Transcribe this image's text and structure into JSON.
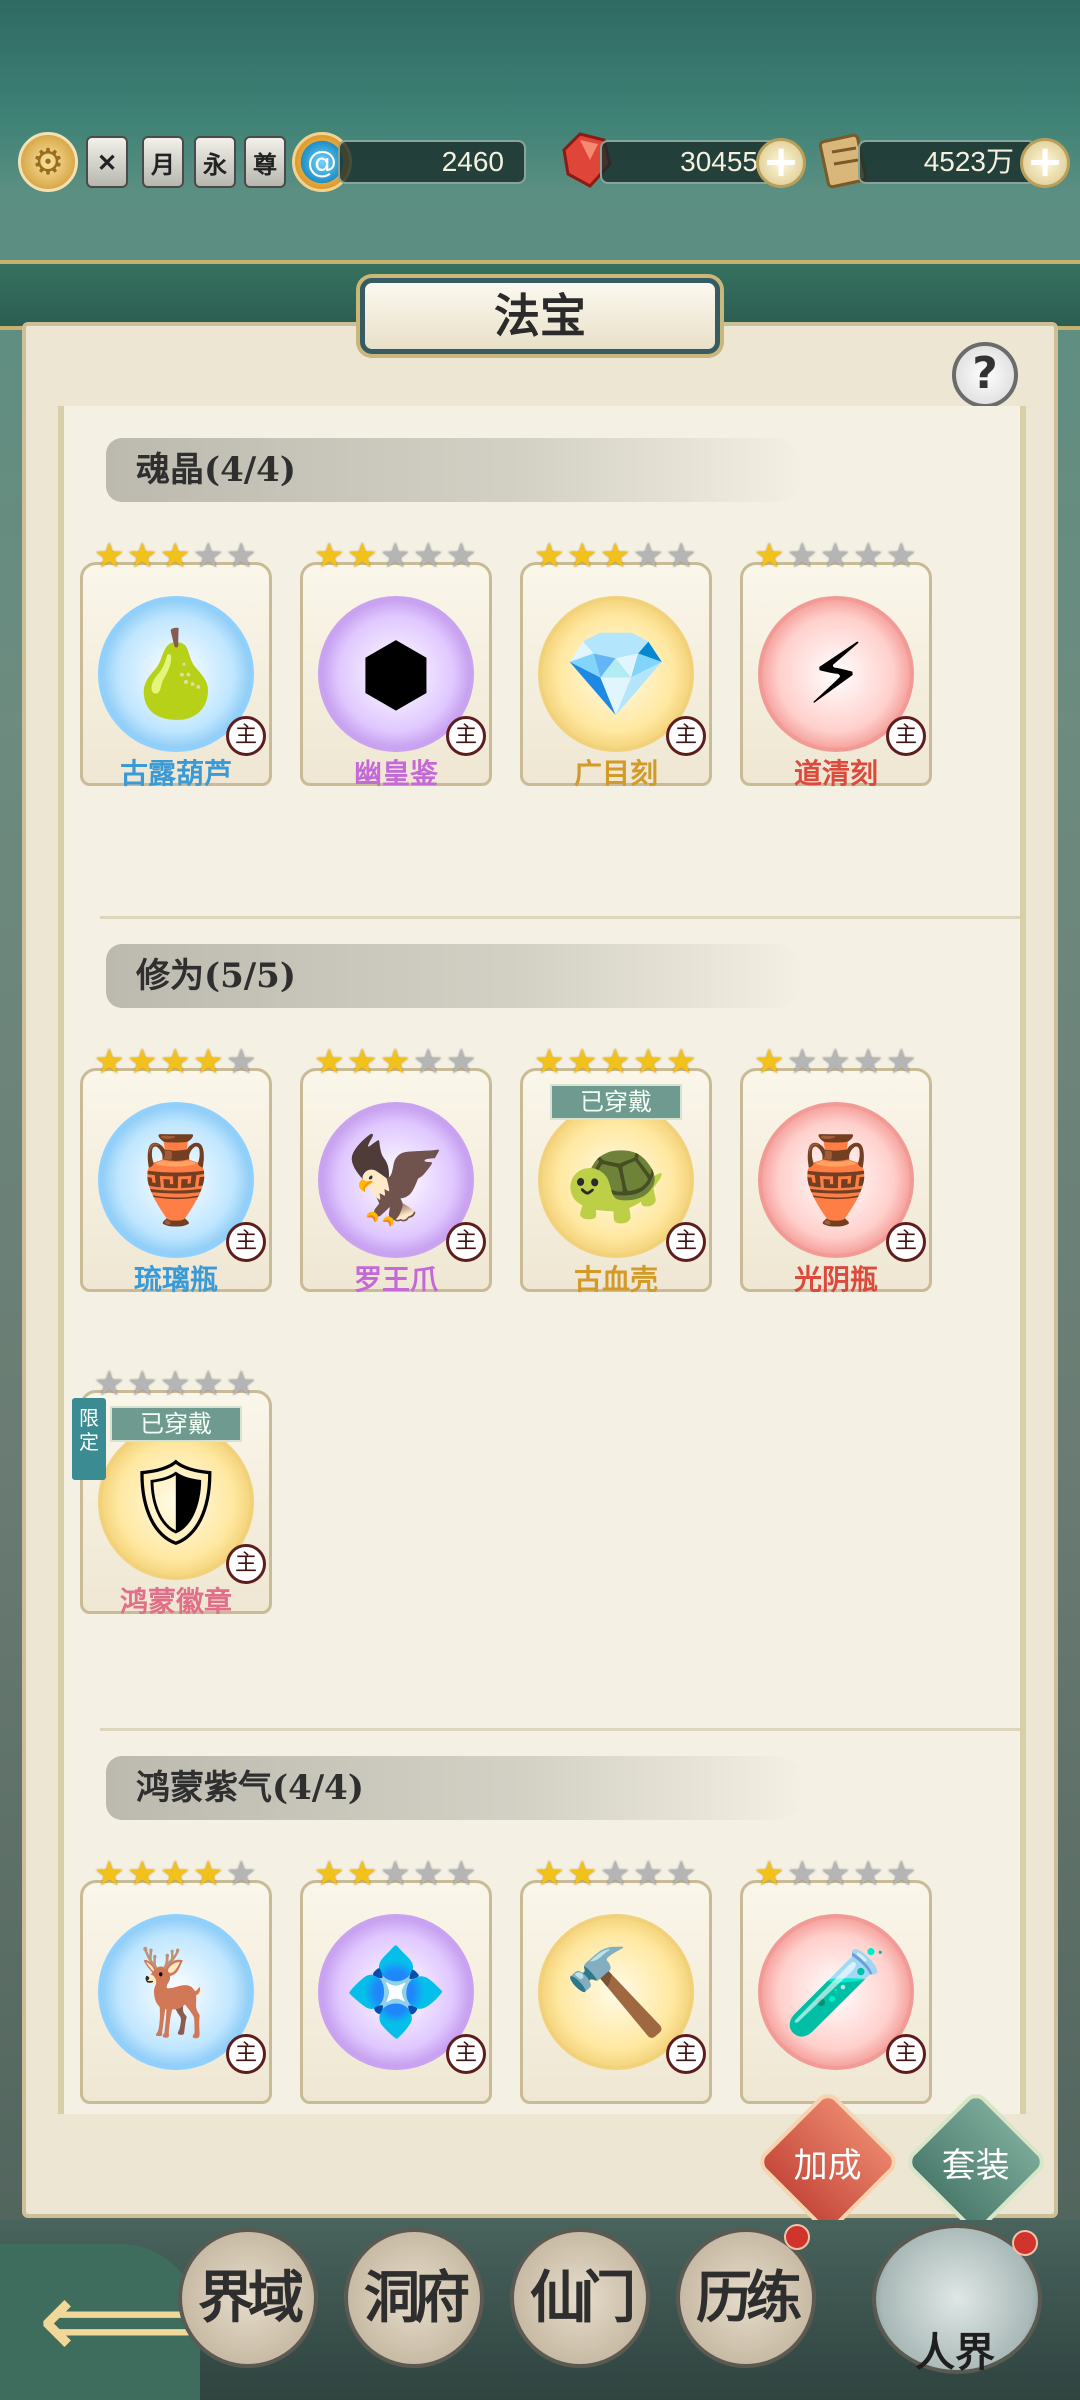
{
  "header": {
    "currency_1": "2460",
    "currency_2": "30455",
    "currency_3": "4523万",
    "badges": [
      "月",
      "永",
      "尊"
    ]
  },
  "page": {
    "title": "法宝"
  },
  "sections": [
    {
      "title": "魂晶(4/4)",
      "items": [
        {
          "name": "古露葫芦",
          "stars": 3,
          "max_stars": 5,
          "rarity": "blue",
          "emoji": "🍐"
        },
        {
          "name": "幽皇鉴",
          "stars": 2,
          "max_stars": 5,
          "rarity": "purple",
          "emoji": "⬢"
        },
        {
          "name": "广目刻",
          "stars": 3,
          "max_stars": 5,
          "rarity": "gold",
          "emoji": "💎"
        },
        {
          "name": "道清刻",
          "stars": 1,
          "max_stars": 5,
          "rarity": "red",
          "emoji": "⚡"
        }
      ]
    },
    {
      "title": "修为(5/5)",
      "items": [
        {
          "name": "琉璃瓶",
          "stars": 4,
          "max_stars": 5,
          "rarity": "blue",
          "emoji": "🏺"
        },
        {
          "name": "罗王爪",
          "stars": 3,
          "max_stars": 5,
          "rarity": "purple",
          "emoji": "🦅"
        },
        {
          "name": "古血壳",
          "stars": 5,
          "max_stars": 5,
          "rarity": "gold",
          "emoji": "🐢",
          "equipped": "已穿戴"
        },
        {
          "name": "光阴瓶",
          "stars": 1,
          "max_stars": 5,
          "rarity": "red",
          "emoji": "🏺"
        },
        {
          "name": "鸿蒙徽章",
          "stars": 0,
          "max_stars": 5,
          "rarity": "pink",
          "emoji": "🛡",
          "equipped": "已穿戴",
          "limited": "限定"
        }
      ]
    },
    {
      "title": "鸿蒙紫气(4/4)",
      "items": [
        {
          "name": "",
          "stars": 4,
          "max_stars": 5,
          "rarity": "blue",
          "emoji": "🦌"
        },
        {
          "name": "",
          "stars": 2,
          "max_stars": 5,
          "rarity": "purple",
          "emoji": "💠"
        },
        {
          "name": "",
          "stars": 2,
          "max_stars": 5,
          "rarity": "gold",
          "emoji": "🔨"
        },
        {
          "name": "",
          "stars": 1,
          "max_stars": 5,
          "rarity": "red",
          "emoji": "🧪"
        }
      ]
    }
  ],
  "main_tag": "主",
  "actions": {
    "bonus": "加成",
    "set": "套装"
  },
  "bottom_nav": {
    "items": [
      "界域",
      "洞府",
      "仙门",
      "历练"
    ],
    "world": "人界"
  }
}
